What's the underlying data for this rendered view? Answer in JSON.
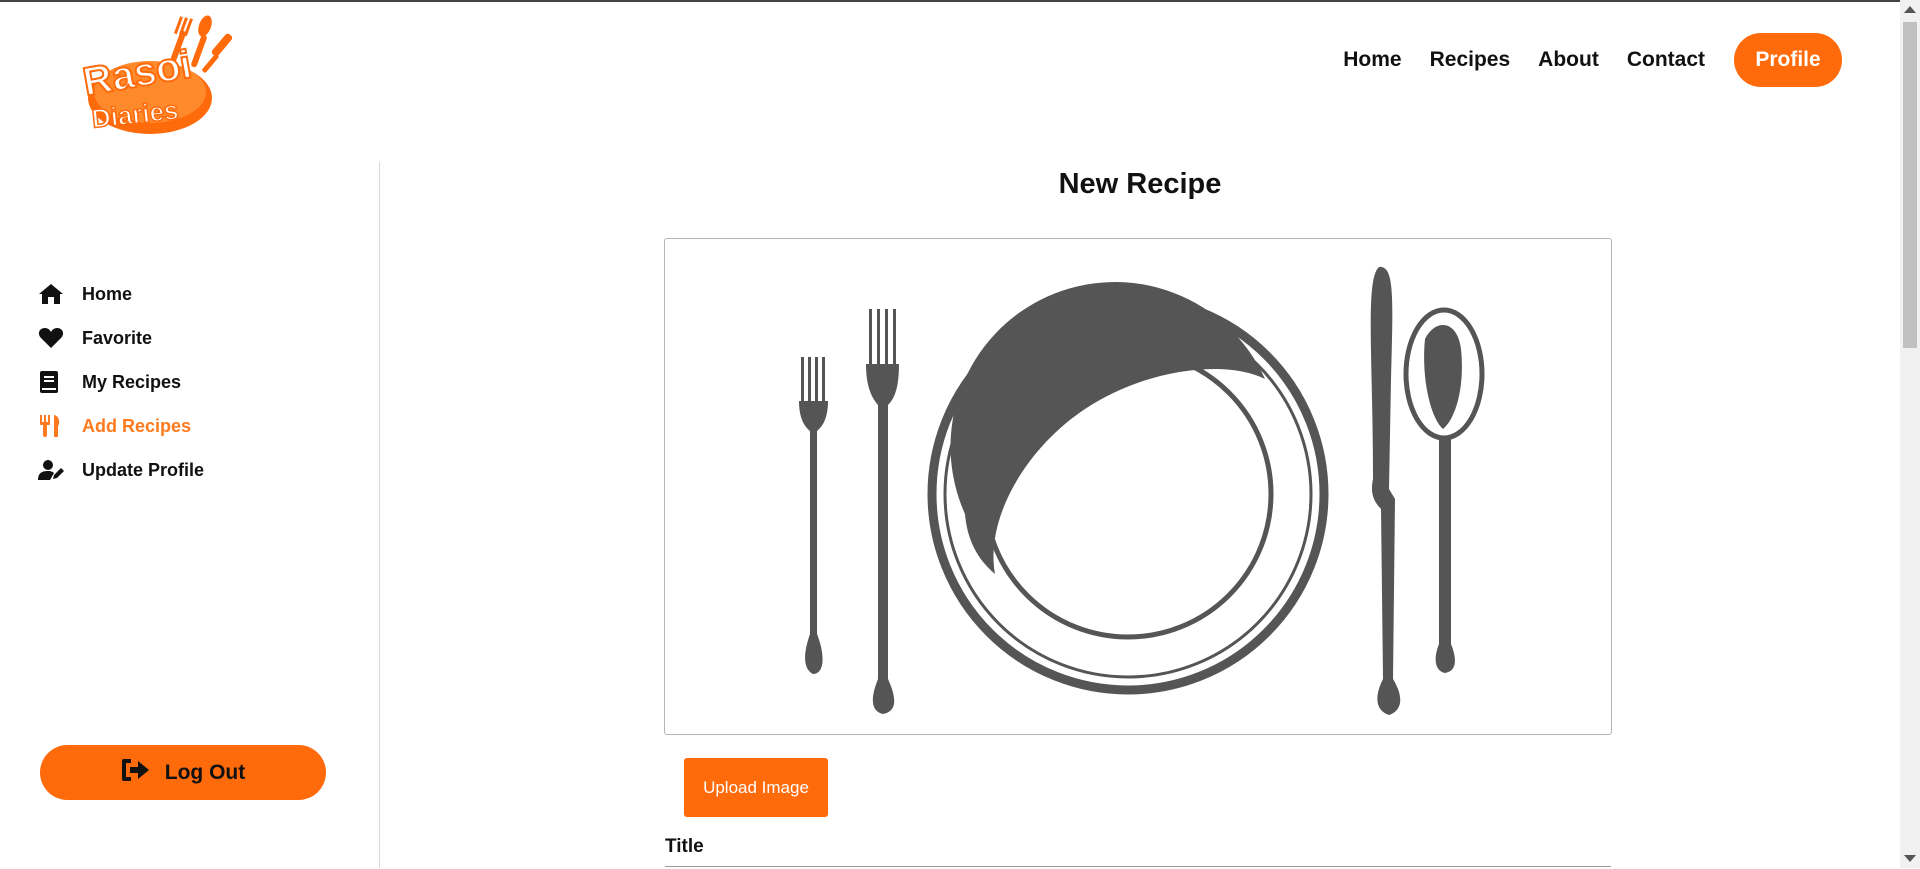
{
  "brand": {
    "line1": "Rasoi",
    "line2": "Diaries",
    "color": "#ff6a0b"
  },
  "nav": {
    "links": [
      "Home",
      "Recipes",
      "About",
      "Contact"
    ],
    "profile_label": "Profile"
  },
  "sidebar": {
    "items": [
      {
        "label": "Home",
        "icon": "home-icon"
      },
      {
        "label": "Favorite",
        "icon": "heart-icon"
      },
      {
        "label": "My Recipes",
        "icon": "book-icon"
      },
      {
        "label": "Add Recipes",
        "icon": "utensils-icon",
        "active": true
      },
      {
        "label": "Update Profile",
        "icon": "user-edit-icon"
      }
    ],
    "logout_label": "Log Out"
  },
  "main": {
    "title": "New Recipe",
    "upload_label": "Upload Image",
    "title_field_label": "Title"
  },
  "colors": {
    "accent": "#ff6a0b",
    "active_text": "#ff7a1e",
    "illustration": "#555555"
  }
}
